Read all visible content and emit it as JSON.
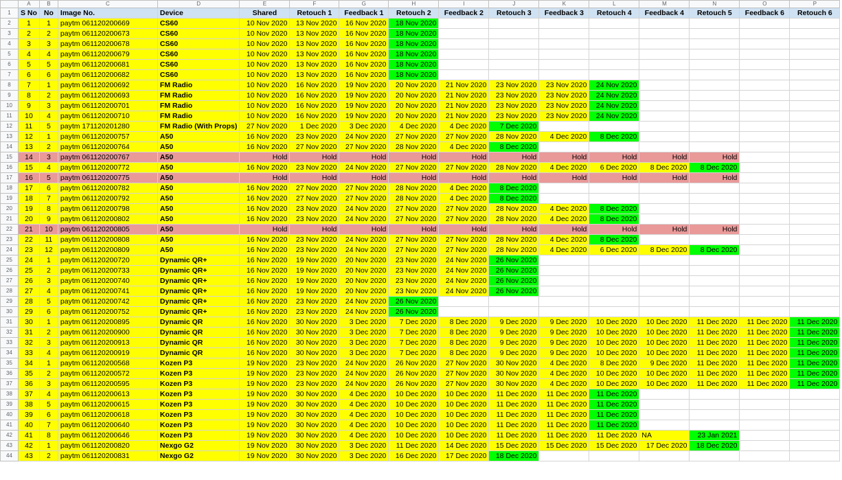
{
  "column_letters": [
    "A",
    "B",
    "C",
    "D",
    "E",
    "F",
    "G",
    "H",
    "I",
    "J",
    "K",
    "L",
    "M",
    "N",
    "O",
    "P"
  ],
  "headers": [
    "S No",
    "No",
    "Image No.",
    "Device",
    "Shared",
    "Retouch 1",
    "Feedback 1",
    "Retouch 2",
    "Feedback 2",
    "Retouch 3",
    "Feedback 3",
    "Retouch 4",
    "Feedback 4",
    "Retouch 5",
    "Feedback 6",
    "Retouch 6"
  ],
  "colors": {
    "yellow": "#ffff00",
    "green": "#00ff00",
    "hold": "#ea9999",
    "header": "#cfe2f3"
  },
  "rows": [
    {
      "row": 2,
      "s": "1",
      "n": "1",
      "img": "paytm 061120200669",
      "dev": "CS60",
      "d": [
        "10 Nov 2020",
        "13 Nov 2020",
        "16 Nov 2020",
        "18 Nov 2020"
      ],
      "g": 3
    },
    {
      "row": 3,
      "s": "2",
      "n": "2",
      "img": "paytm 061120200673",
      "dev": "CS60",
      "d": [
        "10 Nov 2020",
        "13 Nov 2020",
        "16 Nov 2020",
        "18 Nov 2020"
      ],
      "g": 3
    },
    {
      "row": 4,
      "s": "3",
      "n": "3",
      "img": "paytm 061120200678",
      "dev": "CS60",
      "d": [
        "10 Nov 2020",
        "13 Nov 2020",
        "16 Nov 2020",
        "18 Nov 2020"
      ],
      "g": 3
    },
    {
      "row": 5,
      "s": "4",
      "n": "4",
      "img": "paytm 061120200679",
      "dev": "CS60",
      "d": [
        "10 Nov 2020",
        "13 Nov 2020",
        "16 Nov 2020",
        "18 Nov 2020"
      ],
      "g": 3
    },
    {
      "row": 6,
      "s": "5",
      "n": "5",
      "img": "paytm 061120200681",
      "dev": "CS60",
      "d": [
        "10 Nov 2020",
        "13 Nov 2020",
        "16 Nov 2020",
        "18 Nov 2020"
      ],
      "g": 3
    },
    {
      "row": 7,
      "s": "6",
      "n": "6",
      "img": "paytm 061120200682",
      "dev": "CS60",
      "d": [
        "10 Nov 2020",
        "13 Nov 2020",
        "16 Nov 2020",
        "18 Nov 2020"
      ],
      "g": 3
    },
    {
      "row": 8,
      "s": "7",
      "n": "1",
      "img": "paytm 061120200692",
      "dev": "FM Radio",
      "d": [
        "10 Nov 2020",
        "16 Nov 2020",
        "19 Nov 2020",
        "20 Nov 2020",
        "21 Nov 2020",
        "23 Nov 2020",
        "23 Nov 2020",
        "24 Nov 2020"
      ],
      "g": 7
    },
    {
      "row": 9,
      "s": "8",
      "n": "2",
      "img": "paytm 061120200693",
      "dev": "FM Radio",
      "d": [
        "10 Nov 2020",
        "16 Nov 2020",
        "19 Nov 2020",
        "20 Nov 2020",
        "21 Nov 2020",
        "23 Nov 2020",
        "23 Nov 2020",
        "24 Nov 2020"
      ],
      "g": 7
    },
    {
      "row": 10,
      "s": "9",
      "n": "3",
      "img": "paytm 061120200701",
      "dev": "FM Radio",
      "d": [
        "10 Nov 2020",
        "16 Nov 2020",
        "19 Nov 2020",
        "20 Nov 2020",
        "21 Nov 2020",
        "23 Nov 2020",
        "23 Nov 2020",
        "24 Nov 2020"
      ],
      "g": 7
    },
    {
      "row": 11,
      "s": "10",
      "n": "4",
      "img": "paytm 061120200710",
      "dev": "FM Radio",
      "d": [
        "10 Nov 2020",
        "16 Nov 2020",
        "19 Nov 2020",
        "20 Nov 2020",
        "21 Nov 2020",
        "23 Nov 2020",
        "23 Nov 2020",
        "24 Nov 2020"
      ],
      "g": 7
    },
    {
      "row": 12,
      "s": "11",
      "n": "5",
      "img": "paytm 171120201280",
      "dev": "FM Radio (With Props)",
      "d": [
        "27 Nov 2020",
        "1 Dec 2020",
        "3 Dec 2020",
        "4 Dec 2020",
        "4 Dec 2020",
        "7 Dec 2020"
      ],
      "g": 5
    },
    {
      "row": 13,
      "s": "12",
      "n": "1",
      "img": "paytm 061120200757",
      "dev": "A50",
      "d": [
        "16 Nov 2020",
        "23 Nov 2020",
        "24 Nov 2020",
        "27 Nov 2020",
        "27 Nov 2020",
        "28 Nov 2020",
        "4 Dec 2020",
        "8 Dec 2020"
      ],
      "g": 7
    },
    {
      "row": 14,
      "s": "13",
      "n": "2",
      "img": "paytm 061120200764",
      "dev": "A50",
      "d": [
        "16 Nov 2020",
        "27 Nov 2020",
        "27 Nov 2020",
        "28 Nov 2020",
        "4 Dec 2020",
        "8 Dec 2020"
      ],
      "g": 5
    },
    {
      "row": 15,
      "s": "14",
      "n": "3",
      "img": "paytm 061120200767",
      "dev": "A50",
      "hold": true,
      "d": [
        "Hold",
        "Hold",
        "Hold",
        "Hold",
        "Hold",
        "Hold",
        "Hold",
        "Hold",
        "Hold",
        "Hold"
      ]
    },
    {
      "row": 16,
      "s": "15",
      "n": "4",
      "img": "paytm 061120200772",
      "dev": "A50",
      "d": [
        "16 Nov 2020",
        "23 Nov 2020",
        "24 Nov 2020",
        "27 Nov 2020",
        "27 Nov 2020",
        "28 Nov 2020",
        "4 Dec 2020",
        "6 Dec 2020",
        "8 Dec 2020",
        "8 Dec 2020"
      ],
      "g": 9
    },
    {
      "row": 17,
      "s": "16",
      "n": "5",
      "img": "paytm 061120200775",
      "dev": "A50",
      "hold": true,
      "d": [
        "Hold",
        "Hold",
        "Hold",
        "Hold",
        "Hold",
        "Hold",
        "Hold",
        "Hold",
        "Hold",
        "Hold"
      ]
    },
    {
      "row": 18,
      "s": "17",
      "n": "6",
      "img": "paytm 061120200782",
      "dev": "A50",
      "d": [
        "16 Nov 2020",
        "27 Nov 2020",
        "27 Nov 2020",
        "28 Nov 2020",
        "4 Dec 2020",
        "8 Dec 2020"
      ],
      "g": 5
    },
    {
      "row": 19,
      "s": "18",
      "n": "7",
      "img": "paytm 061120200792",
      "dev": "A50",
      "d": [
        "16 Nov 2020",
        "27 Nov 2020",
        "27 Nov 2020",
        "28 Nov 2020",
        "4 Dec 2020",
        "8 Dec 2020"
      ],
      "g": 5
    },
    {
      "row": 20,
      "s": "19",
      "n": "8",
      "img": "paytm 061120200798",
      "dev": "A50",
      "d": [
        "16 Nov 2020",
        "23 Nov 2020",
        "24 Nov 2020",
        "27 Nov 2020",
        "27 Nov 2020",
        "28 Nov 2020",
        "4 Dec 2020",
        "8 Dec 2020"
      ],
      "g": 7
    },
    {
      "row": 21,
      "s": "20",
      "n": "9",
      "img": "paytm 061120200802",
      "dev": "A50",
      "d": [
        "16 Nov 2020",
        "23 Nov 2020",
        "24 Nov 2020",
        "27 Nov 2020",
        "27 Nov 2020",
        "28 Nov 2020",
        "4 Dec 2020",
        "8 Dec 2020"
      ],
      "g": 7
    },
    {
      "row": 22,
      "s": "21",
      "n": "10",
      "img": "paytm 061120200805",
      "dev": "A50",
      "hold": true,
      "d": [
        "Hold",
        "Hold",
        "Hold",
        "Hold",
        "Hold",
        "Hold",
        "Hold",
        "Hold",
        "Hold",
        "Hold"
      ]
    },
    {
      "row": 23,
      "s": "22",
      "n": "11",
      "img": "paytm 061120200808",
      "dev": "A50",
      "d": [
        "16 Nov 2020",
        "23 Nov 2020",
        "24 Nov 2020",
        "27 Nov 2020",
        "27 Nov 2020",
        "28 Nov 2020",
        "4 Dec 2020",
        "8 Dec 2020"
      ],
      "g": 7
    },
    {
      "row": 24,
      "s": "23",
      "n": "12",
      "img": "paytm 061120200809",
      "dev": "A50",
      "d": [
        "16 Nov 2020",
        "23 Nov 2020",
        "24 Nov 2020",
        "27 Nov 2020",
        "27 Nov 2020",
        "28 Nov 2020",
        "4 Dec 2020",
        "6 Dec 2020",
        "8 Dec 2020",
        "8 Dec 2020"
      ],
      "g": 9
    },
    {
      "row": 25,
      "s": "24",
      "n": "1",
      "img": "paytm 061120200720",
      "dev": "Dynamic QR+",
      "d": [
        "16 Nov 2020",
        "19 Nov 2020",
        "20 Nov 2020",
        "23 Nov 2020",
        "24 Nov 2020",
        "26 Nov 2020"
      ],
      "g": 5
    },
    {
      "row": 26,
      "s": "25",
      "n": "2",
      "img": "paytm 061120200733",
      "dev": "Dynamic QR+",
      "d": [
        "16 Nov 2020",
        "19 Nov 2020",
        "20 Nov 2020",
        "23 Nov 2020",
        "24 Nov 2020",
        "26 Nov 2020"
      ],
      "g": 5
    },
    {
      "row": 27,
      "s": "26",
      "n": "3",
      "img": "paytm 061120200740",
      "dev": "Dynamic QR+",
      "d": [
        "16 Nov 2020",
        "19 Nov 2020",
        "20 Nov 2020",
        "23 Nov 2020",
        "24 Nov 2020",
        "26 Nov 2020"
      ],
      "g": 5
    },
    {
      "row": 28,
      "s": "27",
      "n": "4",
      "img": "paytm 061120200741",
      "dev": "Dynamic QR+",
      "d": [
        "16 Nov 2020",
        "19 Nov 2020",
        "20 Nov 2020",
        "23 Nov 2020",
        "24 Nov 2020",
        "26 Nov 2020"
      ],
      "g": 5
    },
    {
      "row": 29,
      "s": "28",
      "n": "5",
      "img": "paytm 061120200742",
      "dev": "Dynamic QR+",
      "d": [
        "16 Nov 2020",
        "23 Nov 2020",
        "24 Nov 2020",
        "26 Nov 2020"
      ],
      "g": 3
    },
    {
      "row": 30,
      "s": "29",
      "n": "6",
      "img": "paytm 061120200752",
      "dev": "Dynamic QR+",
      "d": [
        "16 Nov 2020",
        "23 Nov 2020",
        "24 Nov 2020",
        "26 Nov 2020"
      ],
      "g": 3
    },
    {
      "row": 31,
      "s": "30",
      "n": "1",
      "img": "paytm 061120200895",
      "dev": "Dynamic QR",
      "d": [
        "16 Nov 2020",
        "30 Nov 2020",
        "3 Dec 2020",
        "7 Dec 2020",
        "8 Dec 2020",
        "9 Dec 2020",
        "9 Dec 2020",
        "10 Dec 2020",
        "10 Dec 2020",
        "11 Dec 2020",
        "11 Dec 2020",
        "11 Dec 2020"
      ],
      "g": 11
    },
    {
      "row": 32,
      "s": "31",
      "n": "2",
      "img": "paytm 061120200900",
      "dev": "Dynamic QR",
      "d": [
        "16 Nov 2020",
        "30 Nov 2020",
        "3 Dec 2020",
        "7 Dec 2020",
        "8 Dec 2020",
        "9 Dec 2020",
        "9 Dec 2020",
        "10 Dec 2020",
        "10 Dec 2020",
        "11 Dec 2020",
        "11 Dec 2020",
        "11 Dec 2020"
      ],
      "g": 11
    },
    {
      "row": 33,
      "s": "32",
      "n": "3",
      "img": "paytm 061120200913",
      "dev": "Dynamic QR",
      "d": [
        "16 Nov 2020",
        "30 Nov 2020",
        "3 Dec 2020",
        "7 Dec 2020",
        "8 Dec 2020",
        "9 Dec 2020",
        "9 Dec 2020",
        "10 Dec 2020",
        "10 Dec 2020",
        "11 Dec 2020",
        "11 Dec 2020",
        "11 Dec 2020"
      ],
      "g": 11
    },
    {
      "row": 34,
      "s": "33",
      "n": "4",
      "img": "paytm 061120200919",
      "dev": "Dynamic QR",
      "d": [
        "16 Nov 2020",
        "30 Nov 2020",
        "3 Dec 2020",
        "7 Dec 2020",
        "8 Dec 2020",
        "9 Dec 2020",
        "9 Dec 2020",
        "10 Dec 2020",
        "10 Dec 2020",
        "11 Dec 2020",
        "11 Dec 2020",
        "11 Dec 2020"
      ],
      "g": 11
    },
    {
      "row": 35,
      "s": "34",
      "n": "1",
      "img": "paytm 061120200568",
      "dev": "Kozen P3",
      "d": [
        "19 Nov 2020",
        "23 Nov 2020",
        "24 Nov 2020",
        "26 Nov 2020",
        "27 Nov 2020",
        "30 Nov 2020",
        "4 Dec 2020",
        "8 Dec 2020",
        "9 Dec 2020",
        "11 Dec 2020",
        "11 Dec 2020",
        "11 Dec 2020"
      ],
      "g": 11
    },
    {
      "row": 36,
      "s": "35",
      "n": "2",
      "img": "paytm 061120200572",
      "dev": "Kozen P3",
      "d": [
        "19 Nov 2020",
        "23 Nov 2020",
        "24 Nov 2020",
        "26 Nov 2020",
        "27 Nov 2020",
        "30 Nov 2020",
        "4 Dec 2020",
        "10 Dec 2020",
        "10 Dec 2020",
        "11 Dec 2020",
        "11 Dec 2020",
        "11 Dec 2020"
      ],
      "g": 11
    },
    {
      "row": 37,
      "s": "36",
      "n": "3",
      "img": "paytm 061120200595",
      "dev": "Kozen P3",
      "d": [
        "19 Nov 2020",
        "23 Nov 2020",
        "24 Nov 2020",
        "26 Nov 2020",
        "27 Nov 2020",
        "30 Nov 2020",
        "4 Dec 2020",
        "10 Dec 2020",
        "10 Dec 2020",
        "11 Dec 2020",
        "11 Dec 2020",
        "11 Dec 2020"
      ],
      "g": 11
    },
    {
      "row": 38,
      "s": "37",
      "n": "4",
      "img": "paytm 061120200613",
      "dev": "Kozen P3",
      "d": [
        "19 Nov 2020",
        "30 Nov 2020",
        "4 Dec 2020",
        "10 Dec 2020",
        "10 Dec 2020",
        "11 Dec 2020",
        "11 Dec 2020",
        "11 Dec 2020"
      ],
      "g": 7
    },
    {
      "row": 39,
      "s": "38",
      "n": "5",
      "img": "paytm 061120200615",
      "dev": "Kozen P3",
      "d": [
        "19 Nov 2020",
        "30 Nov 2020",
        "4 Dec 2020",
        "10 Dec 2020",
        "10 Dec 2020",
        "11 Dec 2020",
        "11 Dec 2020",
        "11 Dec 2020"
      ],
      "g": 7
    },
    {
      "row": 40,
      "s": "39",
      "n": "6",
      "img": "paytm 061120200618",
      "dev": "Kozen P3",
      "d": [
        "19 Nov 2020",
        "30 Nov 2020",
        "4 Dec 2020",
        "10 Dec 2020",
        "10 Dec 2020",
        "11 Dec 2020",
        "11 Dec 2020",
        "11 Dec 2020"
      ],
      "g": 7
    },
    {
      "row": 41,
      "s": "40",
      "n": "7",
      "img": "paytm 061120200640",
      "dev": "Kozen P3",
      "d": [
        "19 Nov 2020",
        "30 Nov 2020",
        "4 Dec 2020",
        "10 Dec 2020",
        "10 Dec 2020",
        "11 Dec 2020",
        "11 Dec 2020",
        "11 Dec 2020"
      ],
      "g": 7
    },
    {
      "row": 42,
      "s": "41",
      "n": "8",
      "img": "paytm 061120200646",
      "dev": "Kozen P3",
      "d": [
        "19 Nov 2020",
        "30 Nov 2020",
        "4 Dec 2020",
        "10 Dec 2020",
        "10 Dec 2020",
        "11 Dec 2020",
        "11 Dec 2020",
        "11 Dec 2020",
        "NA",
        "23 Jan 2021"
      ],
      "g": 9
    },
    {
      "row": 43,
      "s": "42",
      "n": "1",
      "img": "paytm 061120200820",
      "dev": "Nexgo G2",
      "d": [
        "19 Nov 2020",
        "30 Nov 2020",
        "3 Dec 2020",
        "11 Dec 2020",
        "14 Dec 2020",
        "15 Dec 2020",
        "15 Dec 2020",
        "15 Dec 2020",
        "17 Dec 2020",
        "18 Dec 2020"
      ],
      "g": 9
    },
    {
      "row": 44,
      "s": "43",
      "n": "2",
      "img": "paytm 061120200831",
      "dev": "Nexgo G2",
      "d": [
        "19 Nov 2020",
        "30 Nov 2020",
        "3 Dec 2020",
        "16 Dec 2020",
        "17 Dec 2020",
        "18 Dec 2020"
      ],
      "g": 5
    }
  ]
}
